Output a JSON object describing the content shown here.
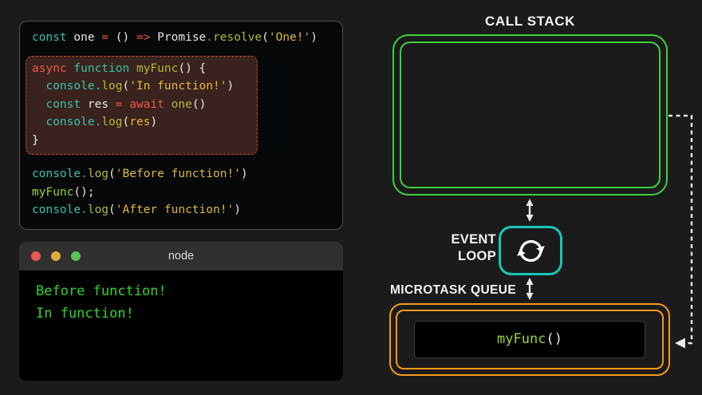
{
  "colors": {
    "page_bg": "#1b1b1b",
    "editor_bg": "#060809",
    "editor_border": "#4e4e4e",
    "highlight_bg": "#3a221e",
    "highlight_border": "#c04b33",
    "teal": "#38c2a5",
    "red": "#e85948",
    "olive": "#b2ba33",
    "lime": "#9ed330",
    "gold": "#e0b93f",
    "plain": "#e9e7e2",
    "terminal_bar": "#303030",
    "terminal_bg": "#010101",
    "terminal_green": "#30d430",
    "stack_green": "#3ed03e",
    "loop_teal": "#15c7b5",
    "queue_orange": "#f5991e",
    "label_white": "#f3f3f3",
    "dot_red": "#e6594e",
    "dot_yellow": "#e1aa3c",
    "dot_green": "#58c455",
    "arrow_white": "#eaeaea"
  },
  "editor": {
    "pre_lines": [
      [
        [
          "kw",
          "const"
        ],
        [
          "plain",
          " one "
        ],
        [
          "red",
          "="
        ],
        [
          "plain",
          " () "
        ],
        [
          "red",
          "=>"
        ],
        [
          "plain",
          " Promise"
        ],
        [
          "kw",
          "."
        ],
        [
          "fn",
          "resolve"
        ],
        [
          "plain",
          "("
        ],
        [
          "str",
          "'One!'"
        ],
        [
          "plain",
          ")"
        ]
      ]
    ],
    "block_lines": [
      [
        [
          "red",
          "async"
        ],
        [
          "plain",
          " "
        ],
        [
          "kw",
          "function"
        ],
        [
          "plain",
          " "
        ],
        [
          "fn",
          "myFunc"
        ],
        [
          "plain",
          "() {"
        ]
      ],
      [
        [
          "plain",
          "  "
        ],
        [
          "kw",
          "console"
        ],
        [
          "kw",
          "."
        ],
        [
          "fn",
          "log"
        ],
        [
          "plain",
          "("
        ],
        [
          "str",
          "'In function!'"
        ],
        [
          "plain",
          ")"
        ]
      ],
      [
        [
          "plain",
          "  "
        ],
        [
          "kw",
          "const"
        ],
        [
          "plain",
          " res "
        ],
        [
          "red",
          "="
        ],
        [
          "plain",
          " "
        ],
        [
          "red",
          "await"
        ],
        [
          "plain",
          " "
        ],
        [
          "fn",
          "one"
        ],
        [
          "plain",
          "()"
        ]
      ],
      [
        [
          "plain",
          "  "
        ],
        [
          "kw",
          "console"
        ],
        [
          "kw",
          "."
        ],
        [
          "fn",
          "log"
        ],
        [
          "plain",
          "("
        ],
        [
          "str",
          "res"
        ],
        [
          "plain",
          ")"
        ]
      ],
      [
        [
          "plain",
          "}"
        ]
      ]
    ],
    "post_lines": [
      [
        [
          "kw",
          "console"
        ],
        [
          "kw",
          "."
        ],
        [
          "fn",
          "log"
        ],
        [
          "plain",
          "("
        ],
        [
          "str",
          "'Before function!'"
        ],
        [
          "plain",
          ")"
        ]
      ],
      [
        [
          "lime",
          "myFunc"
        ],
        [
          "plain",
          "();"
        ]
      ],
      [
        [
          "kw",
          "console"
        ],
        [
          "kw",
          "."
        ],
        [
          "fn",
          "log"
        ],
        [
          "plain",
          "("
        ],
        [
          "str",
          "'After function!'"
        ],
        [
          "plain",
          ")"
        ]
      ]
    ]
  },
  "terminal": {
    "title": "node",
    "lines": [
      "Before function!",
      "In function!"
    ]
  },
  "diagram": {
    "call_stack_label": "CALL STACK",
    "event_loop_lines": [
      "EVENT",
      "LOOP"
    ],
    "microtask_label": "MICROTASK QUEUE",
    "queue_item_tokens": [
      [
        "lime",
        "myFunc"
      ],
      [
        "plain",
        "()"
      ]
    ]
  }
}
